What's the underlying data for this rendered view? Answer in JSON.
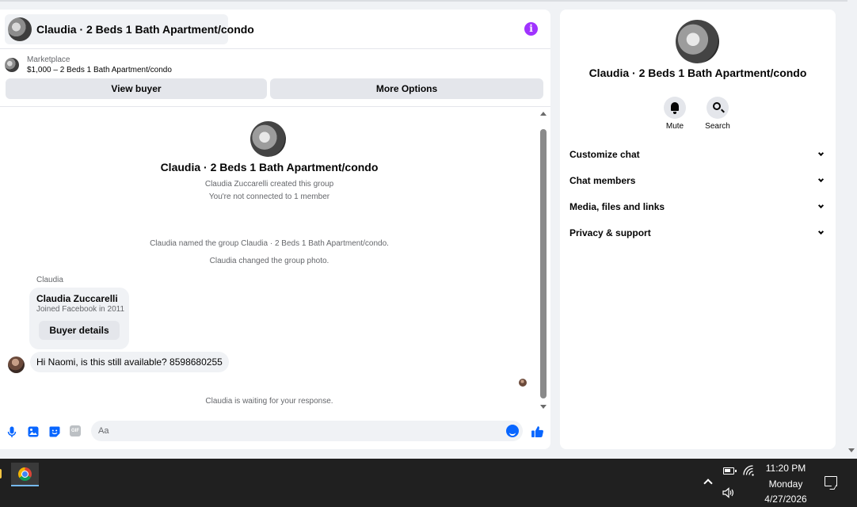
{
  "chat": {
    "title": "Claudia · 2 Beds 1 Bath Apartment/condo",
    "listing": {
      "category": "Marketplace",
      "title": "$1,000 – 2 Beds 1 Bath Apartment/condo"
    },
    "buttons": {
      "view_buyer": "View buyer",
      "more_options": "More Options"
    },
    "group_title": "Claudia · 2 Beds 1 Bath Apartment/condo",
    "group_created": "Claudia Zuccarelli created this group",
    "not_connected": "You're not connected to 1 member",
    "events": [
      "Claudia named the group Claudia · 2 Beds 1 Bath Apartment/condo.",
      "Claudia changed the group photo."
    ],
    "sender_name": "Claudia",
    "profile_card": {
      "name": "Claudia Zuccarelli",
      "subtitle": "Joined Facebook in 2011",
      "button": "Buyer details"
    },
    "message": "Hi Naomi, is this still available? 8598680255",
    "waiting": "Claudia is waiting for your response.",
    "composer_placeholder": "Aa",
    "gif_label": "GIF"
  },
  "info_panel": {
    "title": "Claudia · 2 Beds 1 Bath Apartment/condo",
    "actions": [
      {
        "label": "Mute",
        "icon": "bell-icon"
      },
      {
        "label": "Search",
        "icon": "search-icon"
      }
    ],
    "sections": [
      "Customize chat",
      "Chat members",
      "Media, files and links",
      "Privacy & support"
    ]
  },
  "taskbar": {
    "time": "11:20 PM",
    "day": "Monday",
    "date": "4/27/2026"
  },
  "colors": {
    "accent": "#0866ff",
    "info_icon": "#a033ff",
    "bubble": "#f0f2f5",
    "taskbar": "#202020"
  }
}
